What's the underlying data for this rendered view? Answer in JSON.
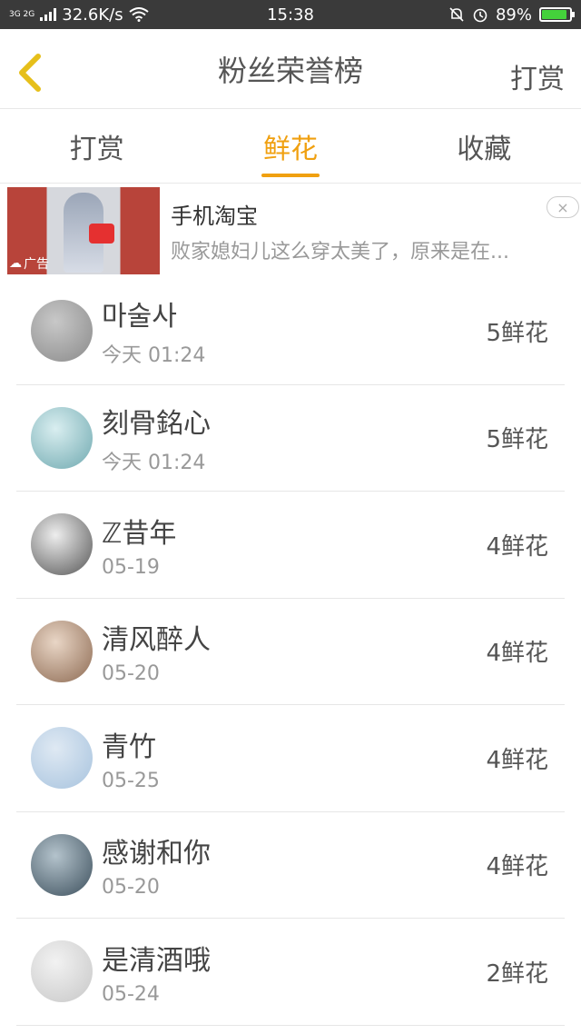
{
  "status_bar": {
    "network": "3G 2G",
    "speed": "32.6K/s",
    "time": "15:38",
    "battery": "89%",
    "battery_level": 0.89
  },
  "header": {
    "title": "粉丝荣誉榜",
    "action": "打赏"
  },
  "tabs": [
    {
      "label": "打赏"
    },
    {
      "label": "鲜花",
      "active": true
    },
    {
      "label": "收藏"
    }
  ],
  "ad": {
    "title": "手机淘宝",
    "desc": "败家媳妇儿这么穿太美了，原来是在...",
    "badge": "广告",
    "close": "×"
  },
  "fans": [
    {
      "name": "마술사",
      "time": "今天 01:24",
      "amount": "5鲜花",
      "avatar_colors": [
        "#c8c8c8",
        "#8a8a8a"
      ]
    },
    {
      "name": "刻骨銘心",
      "time": "今天 01:24",
      "amount": "5鲜花",
      "avatar_colors": [
        "#d9eef0",
        "#6fa9b0"
      ]
    },
    {
      "name": "ℤ昔年",
      "time": "05-19",
      "amount": "4鲜花",
      "avatar_colors": [
        "#eeeeee",
        "#555555"
      ]
    },
    {
      "name": "清风醉人",
      "time": "05-20",
      "amount": "4鲜花",
      "avatar_colors": [
        "#e9d6c6",
        "#8d6a52"
      ]
    },
    {
      "name": "青竹",
      "time": "05-25",
      "amount": "4鲜花",
      "avatar_colors": [
        "#dfe9f3",
        "#a7c3de"
      ]
    },
    {
      "name": "感谢和你",
      "time": "05-20",
      "amount": "4鲜花",
      "avatar_colors": [
        "#b4c3cc",
        "#3c4f5c"
      ]
    },
    {
      "name": "是清酒哦",
      "time": "05-24",
      "amount": "2鲜花",
      "avatar_colors": [
        "#f2f2f2",
        "#c7c7c7"
      ]
    }
  ]
}
